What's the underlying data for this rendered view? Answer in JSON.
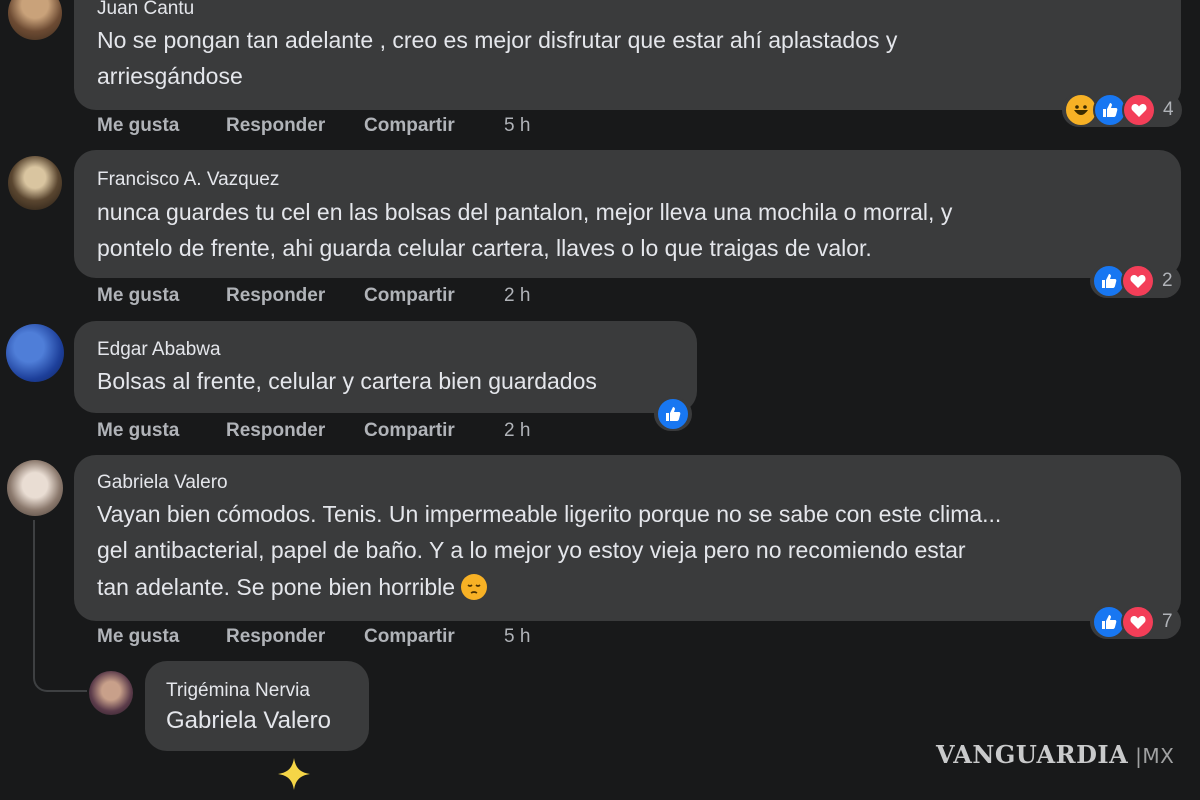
{
  "comments": [
    {
      "author": "Juan Cantu",
      "lines": [
        "No se pongan tan adelante , creo es mejor disfrutar que estar ahí aplastados y",
        "arriesgándose"
      ],
      "actions": {
        "like": "Me gusta",
        "reply": "Responder",
        "share": "Compartir",
        "time": "5 h"
      },
      "reactions": [
        "haha",
        "like",
        "love"
      ],
      "reaction_count": "4"
    },
    {
      "author": "Francisco A. Vazquez",
      "lines": [
        "nunca guardes tu cel en las bolsas del pantalon, mejor lleva una mochila o morral, y",
        "pontelo de frente, ahi guarda celular cartera, llaves o lo que traigas de valor."
      ],
      "actions": {
        "like": "Me gusta",
        "reply": "Responder",
        "share": "Compartir",
        "time": "2 h"
      },
      "reactions": [
        "like",
        "love"
      ],
      "reaction_count": "2"
    },
    {
      "author": "Edgar Ababwa",
      "lines": [
        "Bolsas al frente, celular y cartera bien guardados"
      ],
      "actions": {
        "like": "Me gusta",
        "reply": "Responder",
        "share": "Compartir",
        "time": "2 h"
      },
      "reactions": [
        "like"
      ],
      "reaction_count": ""
    },
    {
      "author": "Gabriela Valero",
      "lines": [
        "Vayan bien cómodos. Tenis. Un impermeable ligerito porque no se sabe con este clima...",
        "gel antibacterial, papel de baño. Y a lo mejor yo estoy vieja pero no recomiendo estar",
        "tan adelante. Se pone bien horrible"
      ],
      "actions": {
        "like": "Me gusta",
        "reply": "Responder",
        "share": "Compartir",
        "time": "5 h"
      },
      "reactions": [
        "like",
        "love"
      ],
      "reaction_count": "7"
    }
  ],
  "reply": {
    "author": "Trigémina Nervia",
    "text": "Gabriela Valero"
  },
  "watermark": {
    "brand": "VANGUARDIA",
    "suffix": "MX"
  },
  "colors": {
    "background": "#18191a",
    "bubble": "#3a3b3c",
    "like": "#1877f2",
    "love": "#f33e58",
    "haha": "#f7b125"
  }
}
